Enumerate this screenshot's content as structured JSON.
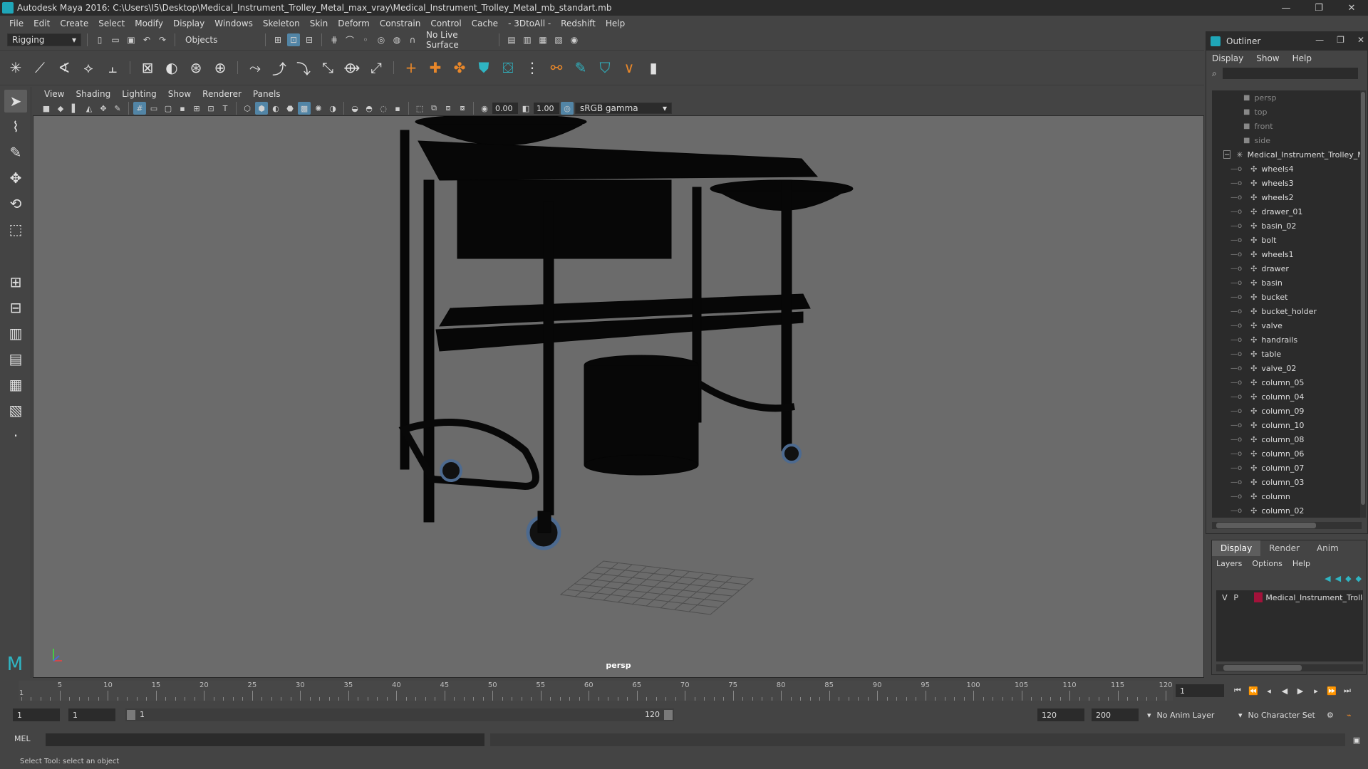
{
  "window": {
    "title": "Autodesk Maya 2016: C:\\Users\\I5\\Desktop\\Medical_Instrument_Trolley_Metal_max_vray\\Medical_Instrument_Trolley_Metal_mb_standart.mb",
    "minimize": "—",
    "maximize": "❐",
    "close": "✕"
  },
  "menu": [
    "File",
    "Edit",
    "Create",
    "Select",
    "Modify",
    "Display",
    "Windows",
    "Skeleton",
    "Skin",
    "Deform",
    "Constrain",
    "Control",
    "Cache",
    "- 3DtoAll -",
    "Redshift",
    "Help"
  ],
  "status": {
    "mode": "Rigging",
    "selection_mode": "Objects",
    "live_surface": "No Live Surface"
  },
  "panel": {
    "menu": [
      "View",
      "Shading",
      "Lighting",
      "Show",
      "Renderer",
      "Panels"
    ],
    "exposure": "0.00",
    "gamma": "1.00",
    "color_space": "sRGB gamma",
    "camera": "persp"
  },
  "outliner": {
    "title": "Outliner",
    "menu": [
      "Display",
      "Show",
      "Help"
    ],
    "cameras": [
      "persp",
      "top",
      "front",
      "side"
    ],
    "group": "Medical_Instrument_Trolley_Metal",
    "children": [
      "wheels4",
      "wheels3",
      "wheels2",
      "drawer_01",
      "basin_02",
      "bolt",
      "wheels1",
      "drawer",
      "basin",
      "bucket",
      "bucket_holder",
      "valve",
      "handrails",
      "table",
      "valve_02",
      "column_05",
      "column_04",
      "column_09",
      "column_10",
      "column_08",
      "column_06",
      "column_07",
      "column_03",
      "column",
      "column_02"
    ]
  },
  "layers": {
    "tabs": [
      "Display",
      "Render",
      "Anim"
    ],
    "menu": [
      "Layers",
      "Options",
      "Help"
    ],
    "row": {
      "v": "V",
      "p": "P",
      "name": "Medical_Instrument_Trolley_Metal"
    }
  },
  "timeline": {
    "ticks": [
      5,
      10,
      15,
      20,
      25,
      30,
      35,
      40,
      45,
      50,
      55,
      60,
      65,
      70,
      75,
      80,
      85,
      90,
      95,
      100,
      105,
      110,
      115,
      120
    ],
    "current_frame": "1",
    "start_marker": "1"
  },
  "range": {
    "start": "1",
    "playback_start": "1",
    "range_start_label": "1",
    "range_end_label": "120",
    "playback_end": "120",
    "end": "200",
    "anim_layer": "No Anim Layer",
    "character_set": "No Character Set"
  },
  "command": {
    "language": "MEL"
  },
  "help_text": "Select Tool: select an object"
}
